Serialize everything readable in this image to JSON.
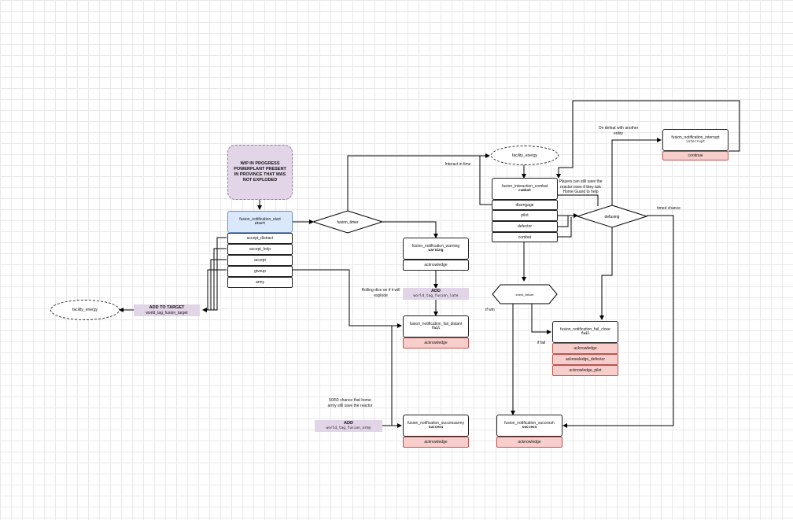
{
  "wip_note": "WIP IN PROGRESS POWERPLANT PRESENT IN PROVINCE THAT WAS NOT EXPLODED",
  "start": {
    "title": "fusion_notification_start",
    "sub": "start",
    "options": [
      "accept_distract",
      "accept_help",
      "accept",
      "giveup",
      "army"
    ]
  },
  "fusion_timer": "fusion_timer",
  "facility_energy_left": "facility_energy",
  "facility_energy_top": "facility_energy",
  "add_target": {
    "title": "ADD TO TARGET",
    "tag": "world_tag_fusion_target"
  },
  "warning": {
    "title": "fusion_notification_warning",
    "sub": "warning",
    "option": "acknowledge"
  },
  "rolling_note": "Rolling dice on if it will explode",
  "add_late": {
    "title": "ADD",
    "tag": "world_tag_fusion_late"
  },
  "fail_distant": {
    "title": "fusion_notification_fail_distant",
    "sub": "fail",
    "option": "acknowledge"
  },
  "army_note": "50/50 chance that home army still save the reactor",
  "add_army": {
    "title": "ADD",
    "tag": "world_tag_fusion_army"
  },
  "success_army": {
    "title": "fusion_notification_successarmy",
    "sub": "success",
    "option": "acknowledge"
  },
  "interact_label": "Interact in time",
  "combat": {
    "title": "fusion_interaction_combat",
    "sub": "combat",
    "options": [
      "disengage",
      "pilot",
      "defector",
      "combat"
    ]
  },
  "players_note": "Players can still save the reactor even if they ask Home Guard to help",
  "defusing": "defusing",
  "timed_chance": "timed chance",
  "defeat_note": "On defeat with another entity",
  "interrupt": {
    "title": "fusion_notification_interrupt",
    "sub": "interrupt",
    "option": "continue"
  },
  "event_fixture": "event_fixture",
  "if_win": "if win",
  "if_fail": "if fail",
  "fail_close": {
    "title": "fusion_notification_fail_close",
    "sub": "fail",
    "options": [
      "acknowledge",
      "acknowledge_defector",
      "acknowledge_pilot"
    ]
  },
  "success": {
    "title": "fusion_notification_successh",
    "sub": "success",
    "option": "acknowledge"
  },
  "colors": {
    "blue_fill": "#dae8fc",
    "red_fill": "#f8cecc",
    "purple_fill": "#e1d5e7",
    "line": "#000000"
  }
}
